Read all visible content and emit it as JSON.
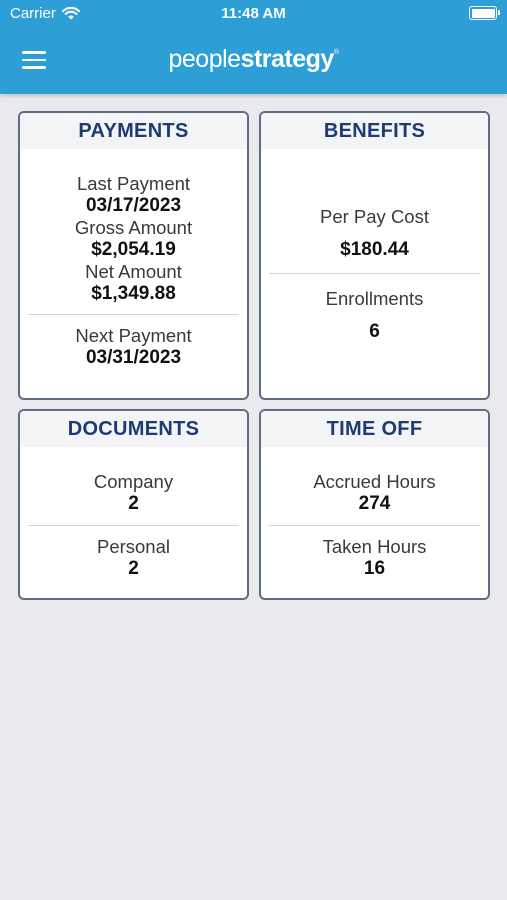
{
  "status_bar": {
    "carrier": "Carrier",
    "time": "11:48 AM"
  },
  "header": {
    "logo_light": "people",
    "logo_bold": "strategy",
    "logo_mark": "®"
  },
  "cards": {
    "payments": {
      "title": "PAYMENTS",
      "last_payment_label": "Last Payment",
      "last_payment_value": "03/17/2023",
      "gross_amount_label": "Gross Amount",
      "gross_amount_value": "$2,054.19",
      "net_amount_label": "Net Amount",
      "net_amount_value": "$1,349.88",
      "next_payment_label": "Next Payment",
      "next_payment_value": "03/31/2023"
    },
    "benefits": {
      "title": "BENEFITS",
      "per_pay_cost_label": "Per Pay Cost",
      "per_pay_cost_value": "$180.44",
      "enrollments_label": "Enrollments",
      "enrollments_value": "6"
    },
    "documents": {
      "title": "DOCUMENTS",
      "company_label": "Company",
      "company_value": "2",
      "personal_label": "Personal",
      "personal_value": "2"
    },
    "time_off": {
      "title": "TIME OFF",
      "accrued_label": "Accrued Hours",
      "accrued_value": "274",
      "taken_label": "Taken Hours",
      "taken_value": "16"
    }
  },
  "colors": {
    "brand_blue": "#2d9fd6",
    "card_title": "#1f3b73",
    "card_border": "#5f6c85",
    "background": "#e9eaed"
  }
}
